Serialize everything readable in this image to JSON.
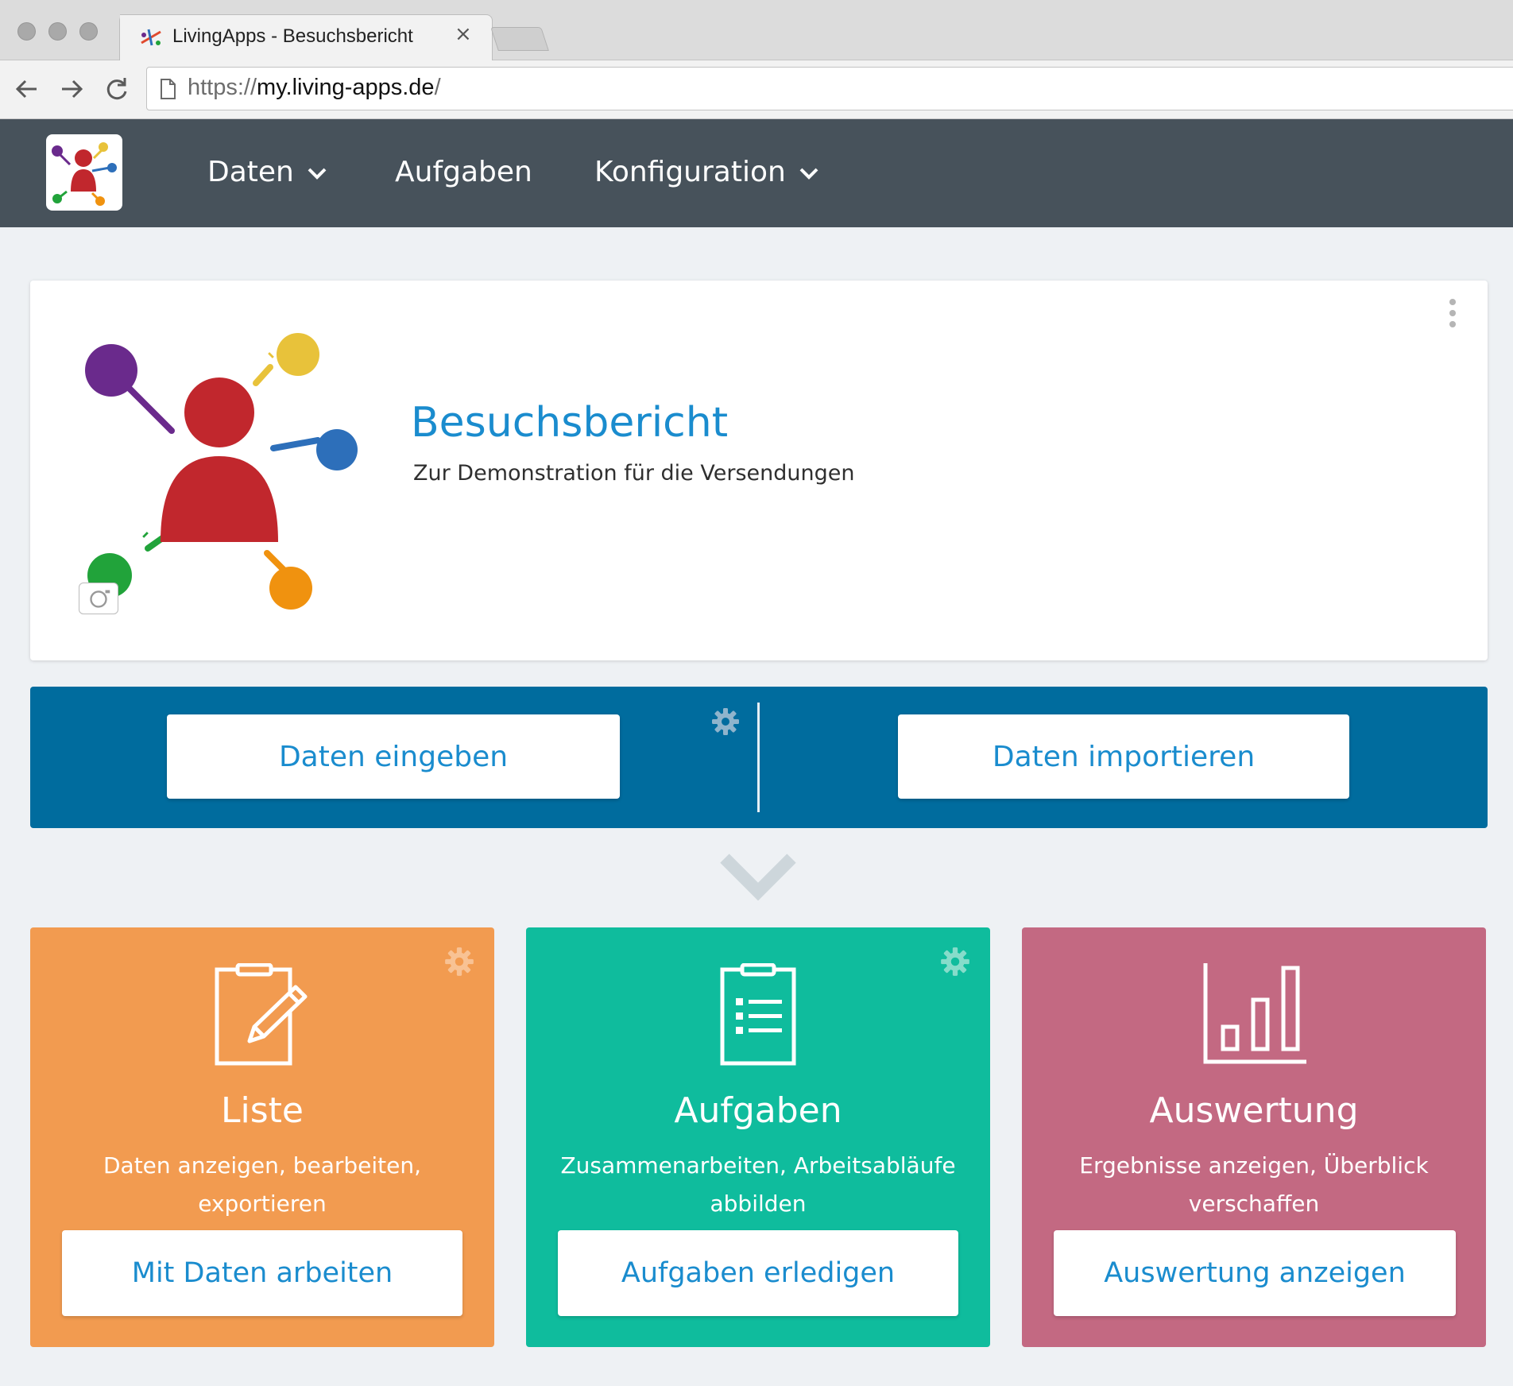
{
  "browser": {
    "tab_title": "LivingApps - Besuchsbericht",
    "tab_close": "×",
    "url_protocol": "https://",
    "url_host": "my.living-apps.de",
    "url_suffix": "/"
  },
  "navbar": {
    "items": [
      {
        "label": "Daten",
        "has_dropdown": true
      },
      {
        "label": "Aufgaben",
        "has_dropdown": false
      },
      {
        "label": "Konfiguration",
        "has_dropdown": true
      }
    ]
  },
  "app": {
    "title": "Besuchsbericht",
    "subtitle": "Zur Demonstration für die Versendungen"
  },
  "actions": {
    "enter_label": "Daten eingeben",
    "import_label": "Daten importieren"
  },
  "cards": [
    {
      "title": "Liste",
      "description": "Daten anzeigen, bearbeiten, exportieren",
      "button": "Mit Daten arbeiten",
      "color": "#f29b50",
      "icon": "clipboard-pencil-icon"
    },
    {
      "title": "Aufgaben",
      "description": "Zusammenarbeiten, Arbeitsabläufe abbilden",
      "button": "Aufgaben erledigen",
      "color": "#0fbc9d",
      "icon": "clipboard-list-icon"
    },
    {
      "title": "Auswertung",
      "description": "Ergebnisse anzeigen, Überblick verschaffen",
      "button": "Auswertung anzeigen",
      "color": "#c36982",
      "icon": "bar-chart-icon"
    }
  ],
  "colors": {
    "navbar": "#47525b",
    "accent": "#1a8cce",
    "band": "#006c9e",
    "page_bg": "#eef1f4"
  }
}
